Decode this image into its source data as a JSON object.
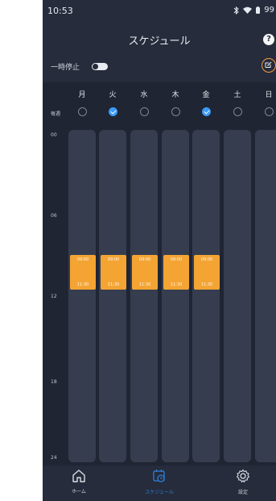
{
  "status_bar": {
    "time": "10:53",
    "battery": "99"
  },
  "header": {
    "title": "スケジュール"
  },
  "pause": {
    "label": "一時停止",
    "enabled": false
  },
  "days": [
    {
      "label": "月",
      "checked": false
    },
    {
      "label": "火",
      "checked": true
    },
    {
      "label": "水",
      "checked": false
    },
    {
      "label": "木",
      "checked": false
    },
    {
      "label": "金",
      "checked": true
    },
    {
      "label": "土",
      "checked": false
    },
    {
      "label": "日",
      "checked": false
    }
  ],
  "every_week_label": "毎週",
  "hours": [
    "00",
    "06",
    "12",
    "18",
    "24"
  ],
  "schedule_blocks": [
    {
      "day_index": 0,
      "start": "09:00",
      "end": "11:30"
    },
    {
      "day_index": 1,
      "start": "09:00",
      "end": "11:30"
    },
    {
      "day_index": 2,
      "start": "09:00",
      "end": "11:30"
    },
    {
      "day_index": 3,
      "start": "09:00",
      "end": "11:30"
    },
    {
      "day_index": 4,
      "start": "09:00",
      "end": "11:30"
    }
  ],
  "bottom_nav": [
    {
      "label": "ホーム",
      "icon": "home-icon",
      "active": false
    },
    {
      "label": "スケジュール",
      "icon": "calendar-clock-icon",
      "active": true
    },
    {
      "label": "設定",
      "icon": "gear-icon",
      "active": false
    }
  ],
  "colors": {
    "background": "#262c3b",
    "accent_blue": "#3b9bf5",
    "accent_orange": "#f4a433"
  }
}
